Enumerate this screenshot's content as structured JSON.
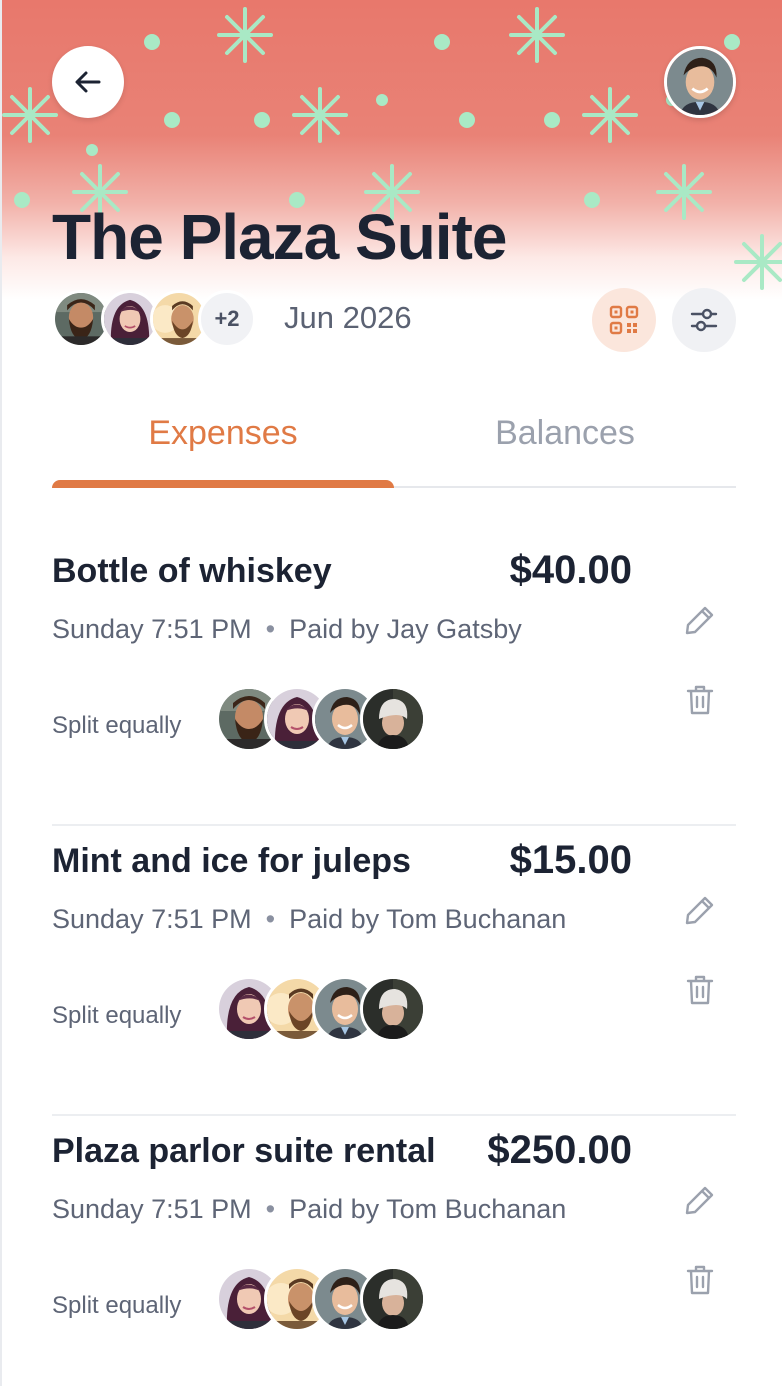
{
  "header": {
    "title": "The Plaza Suite",
    "date": "Jun 2026",
    "more_members": "+2",
    "colors": {
      "banner": "#e8786c",
      "pattern": "#a9e9c5",
      "accent": "#e07a45"
    }
  },
  "tabs": [
    {
      "label": "Expenses",
      "active": true
    },
    {
      "label": "Balances",
      "active": false
    }
  ],
  "expenses": [
    {
      "name": "Bottle of whiskey",
      "amount": "$40.00",
      "time": "Sunday 7:51 PM",
      "paid_by": "Paid by Jay Gatsby",
      "split": "Split equally"
    },
    {
      "name": "Mint and ice for juleps",
      "amount": "$15.00",
      "time": "Sunday 7:51 PM",
      "paid_by": "Paid by Tom Buchanan",
      "split": "Split equally"
    },
    {
      "name": "Plaza parlor suite rental",
      "amount": "$250.00",
      "time": "Sunday 7:51 PM",
      "paid_by": "Paid by Tom Buchanan",
      "split": "Split equally"
    }
  ],
  "icons": {
    "back": "arrow-left-icon",
    "qr": "qr-code-icon",
    "settings": "sliders-icon",
    "edit": "pencil-icon",
    "delete": "trash-icon"
  }
}
